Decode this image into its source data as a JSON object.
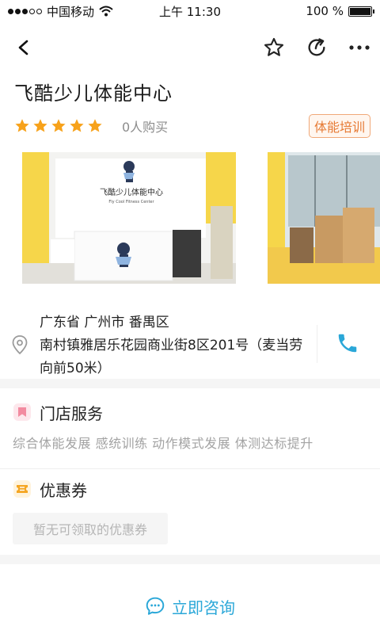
{
  "status_bar": {
    "carrier": "中国移动",
    "time": "上午 11:30",
    "battery_level": "100 %",
    "battery_fill": 1.0
  },
  "nav": {
    "icons": [
      "back-icon",
      "star-icon",
      "share-icon",
      "more-icon"
    ]
  },
  "store": {
    "name": "飞酷少儿体能中心",
    "rating_stars": 5,
    "buyers": "0人购买",
    "category_tag": "体能培训",
    "sign_line1": "飞酷少儿体能中心",
    "sign_line2": "Fly Cool Fitness Center"
  },
  "address": {
    "region": "广东省 广州市 番禺区",
    "street": "南村镇雅居乐花园商业街8区201号（麦当劳向前50米）"
  },
  "services_section": {
    "title": "门店服务",
    "items": "综合体能发展 感统训练 动作模式发展 体测达标提升"
  },
  "coupon_section": {
    "title": "优惠券",
    "empty_text": "暂无可领取的优惠券"
  },
  "bottom_bar": {
    "consult_label": "立即咨询"
  },
  "colors": {
    "star": "#f7a21b",
    "tag_text": "#e67a34",
    "accent_blue": "#2aa7d8",
    "service_icon": "#f28ba0",
    "coupon_icon": "#f5a623"
  }
}
